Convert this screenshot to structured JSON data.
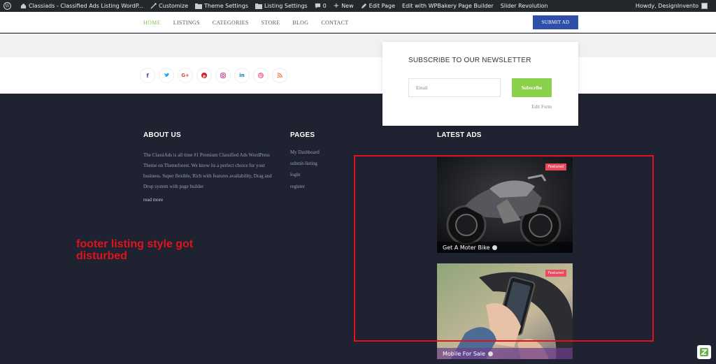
{
  "adminbar": {
    "site_name": "Classiads - Classified Ads Listing WordP...",
    "customize": "Customize",
    "theme_settings": "Theme Settings",
    "listing_settings": "Listing Settings",
    "comments_count": "0",
    "new": "New",
    "edit_page": "Edit Page",
    "wpbakery": "Edit with WPBakery Page Builder",
    "slider": "Slider Revolution",
    "howdy": "Howdy, DesignInvento"
  },
  "nav": {
    "items": [
      "HOME",
      "LISTINGS",
      "CATEGORIES",
      "STORE",
      "BLOG",
      "CONTACT"
    ],
    "submit_ad": "SUBMIT AD",
    "active_color": "#8bc34a"
  },
  "social": [
    {
      "icon": "facebook-icon",
      "glyph": "f",
      "color": "#3b5998"
    },
    {
      "icon": "twitter-icon",
      "glyph": "t",
      "color": "#1da1f2"
    },
    {
      "icon": "google-plus-icon",
      "glyph": "G+",
      "color": "#dd4b39"
    },
    {
      "icon": "pinterest-icon",
      "glyph": "p",
      "color": "#cb2027"
    },
    {
      "icon": "instagram-icon",
      "glyph": "◎",
      "color": "#c13584"
    },
    {
      "icon": "linkedin-icon",
      "glyph": "in",
      "color": "#0077b5"
    },
    {
      "icon": "dribbble-icon",
      "glyph": "⊛",
      "color": "#ea4c89"
    },
    {
      "icon": "rss-icon",
      "glyph": "≋",
      "color": "#f26522"
    }
  ],
  "newsletter": {
    "title": "SUBSCRIBE TO OUR NEWSLETTER",
    "email_placeholder": "Email",
    "button": "Subscribe",
    "edit_form": "Edit Form"
  },
  "footer": {
    "about": {
      "title": "ABOUT US",
      "text": "The ClassiAds is all time #1 Premium Classified Ads WordPress Theme on Themeforest. We know its a perfect choice for your business. Super flexible, Rich with features availability, Drag and Drop system with page builder",
      "read_more": "read more"
    },
    "pages": {
      "title": "PAGES",
      "links": [
        "My Dashboard",
        "submit-listing",
        "login",
        "register"
      ]
    },
    "latest_ads": {
      "title": "LATEST ADS",
      "ads": [
        {
          "title": "Get A Moter Bike",
          "badge": "Featured"
        },
        {
          "title": "Mobile For Sale",
          "badge": "Featured"
        }
      ]
    }
  },
  "annotation": "footer listing style got disturbed",
  "colors": {
    "footer_bg": "#1f2331",
    "accent_green": "#8bd04a",
    "submit_blue": "#2f4fa8",
    "annotation_red": "#e0131d",
    "badge_red": "#e84a5f"
  }
}
